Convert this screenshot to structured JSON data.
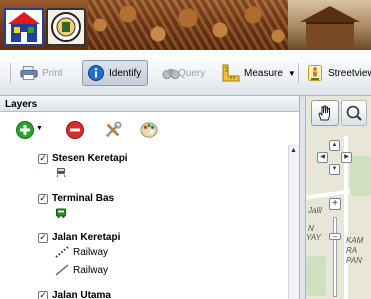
{
  "toolbar": {
    "print_label": "Print",
    "identify_label": "Identify",
    "query_label": "Query",
    "measure_label": "Measure",
    "streetview_label": "Streetview"
  },
  "panel": {
    "title": "Layers"
  },
  "layers": [
    {
      "label": "Stesen Keretapi",
      "checked": true,
      "legend_icon": "train-icon"
    },
    {
      "label": "Terminal Bas",
      "checked": true,
      "legend_icon": "bus-icon"
    },
    {
      "label": "Jalan Keretapi",
      "checked": true,
      "legend": [
        {
          "label": "Railway",
          "icon": "railway-dotted-line-icon"
        },
        {
          "label": "Railway",
          "icon": "railway-solid-line-icon"
        }
      ]
    },
    {
      "label": "Jalan Utama",
      "checked": true
    }
  ],
  "map": {
    "labels": [
      "Jalil",
      "N",
      "YAY",
      "KAM",
      "RA",
      "PAN"
    ]
  },
  "colors": {
    "identify_icon": "#1f6fd1",
    "add_layer": "#2aa52a",
    "remove_layer": "#d92b2b",
    "map_background": "#e8e6d6"
  }
}
